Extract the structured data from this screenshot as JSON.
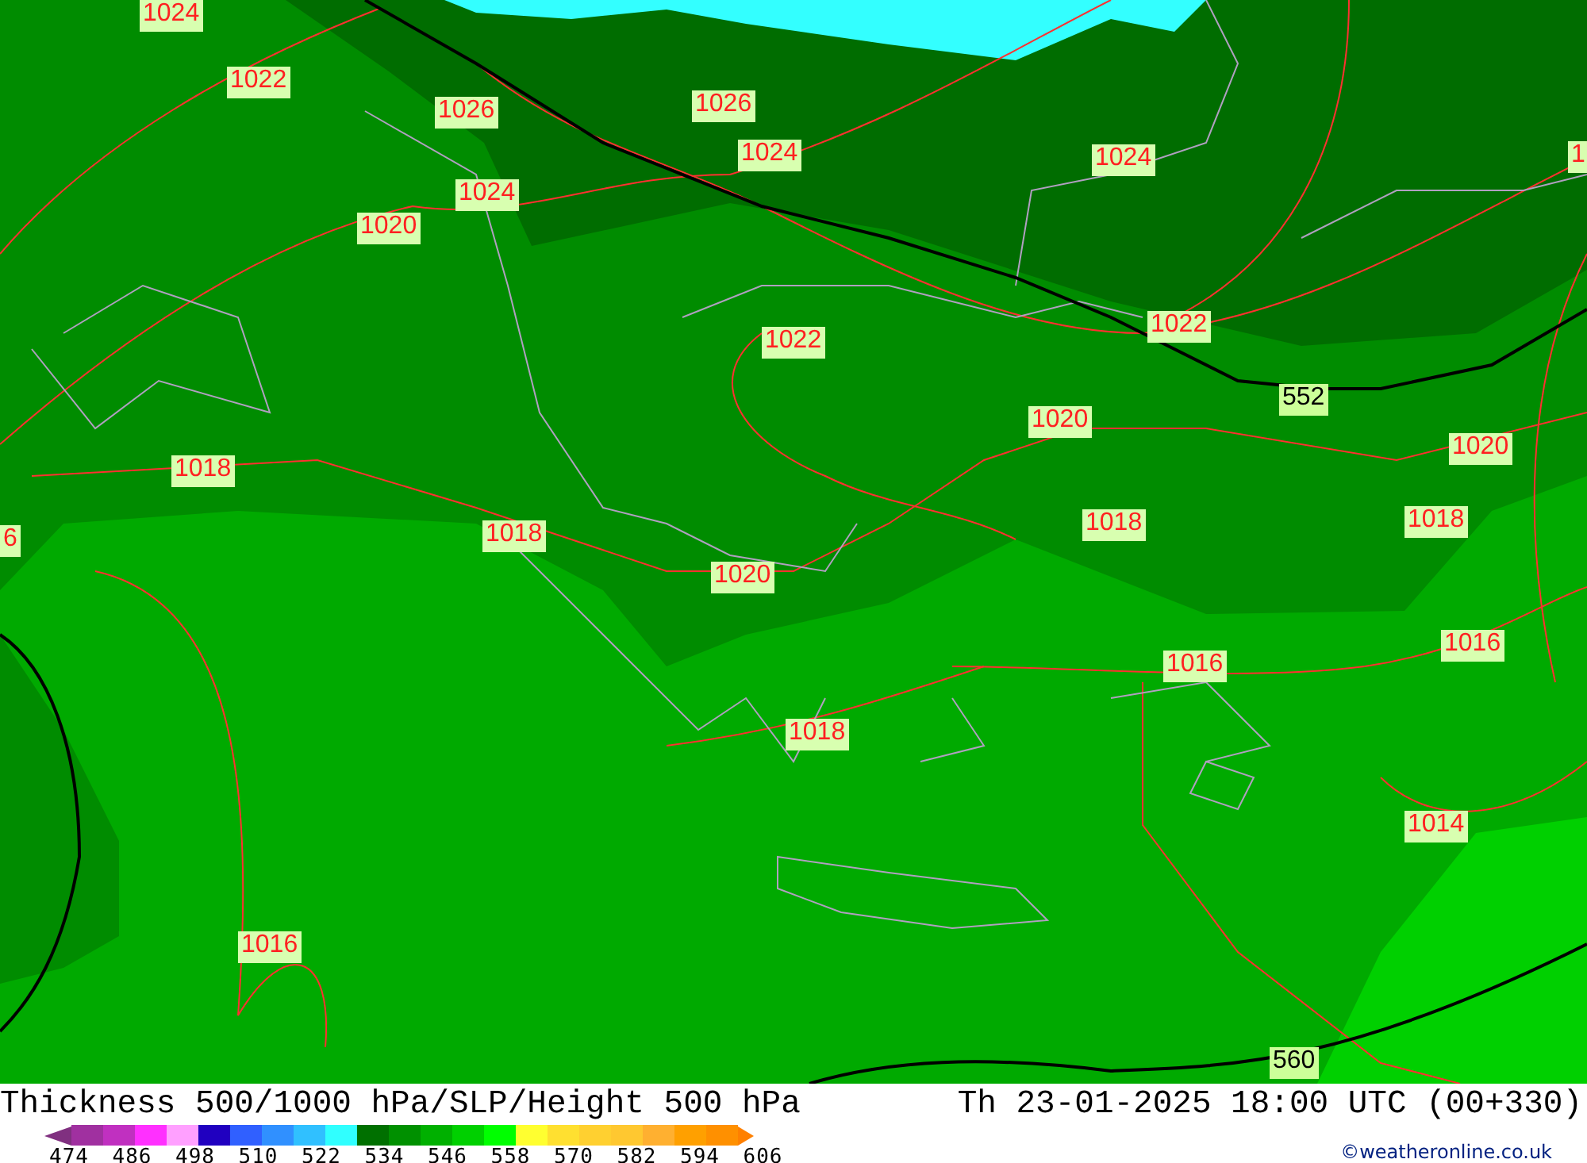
{
  "map": {
    "labels": [
      {
        "kind": "slp",
        "text": "1024"
      },
      {
        "kind": "slp",
        "text": "1022"
      },
      {
        "kind": "slp",
        "text": "1026"
      },
      {
        "kind": "slp",
        "text": "1026"
      },
      {
        "kind": "slp",
        "text": "1024"
      },
      {
        "kind": "slp",
        "text": "1024"
      },
      {
        "kind": "slp",
        "text": "1024"
      },
      {
        "kind": "slp",
        "text": "1"
      },
      {
        "kind": "slp",
        "text": "1020"
      },
      {
        "kind": "slp",
        "text": "1022"
      },
      {
        "kind": "slp",
        "text": "1022"
      },
      {
        "kind": "height",
        "text": "552"
      },
      {
        "kind": "slp",
        "text": "1020"
      },
      {
        "kind": "slp",
        "text": "1020"
      },
      {
        "kind": "slp",
        "text": "1018"
      },
      {
        "kind": "slp",
        "text": "6"
      },
      {
        "kind": "slp",
        "text": "1018"
      },
      {
        "kind": "slp",
        "text": "1018"
      },
      {
        "kind": "slp",
        "text": "1018"
      },
      {
        "kind": "slp",
        "text": "1020"
      },
      {
        "kind": "slp",
        "text": "1016"
      },
      {
        "kind": "slp",
        "text": "1016"
      },
      {
        "kind": "slp",
        "text": "1018"
      },
      {
        "kind": "slp",
        "text": "1014"
      },
      {
        "kind": "slp",
        "text": "1016"
      },
      {
        "kind": "height",
        "text": "560"
      }
    ]
  },
  "footer": {
    "title": "Thickness 500/1000 hPa/SLP/Height 500 hPa",
    "datetime": "Th 23-01-2025 18:00 UTC (00+330)",
    "credit": "©weatheronline.co.uk",
    "legend": {
      "swatches": [
        {
          "color": "#a030a0"
        },
        {
          "color": "#c030c0"
        },
        {
          "color": "#ff30ff"
        },
        {
          "color": "#ffa0ff"
        },
        {
          "color": "#2000c0"
        },
        {
          "color": "#3060ff"
        },
        {
          "color": "#3090ff"
        },
        {
          "color": "#30c0ff"
        },
        {
          "color": "#30ffff"
        },
        {
          "color": "#007000"
        },
        {
          "color": "#009000"
        },
        {
          "color": "#00b000"
        },
        {
          "color": "#00d000"
        },
        {
          "color": "#00ff00"
        },
        {
          "color": "#ffff30"
        },
        {
          "color": "#ffe030"
        },
        {
          "color": "#ffd030"
        },
        {
          "color": "#ffc830"
        },
        {
          "color": "#ffb030"
        },
        {
          "color": "#ffa000"
        },
        {
          "color": "#ff9000"
        }
      ],
      "ticks": [
        "474",
        "486",
        "498",
        "510",
        "522",
        "534",
        "546",
        "558",
        "570",
        "582",
        "594",
        "606"
      ]
    }
  }
}
